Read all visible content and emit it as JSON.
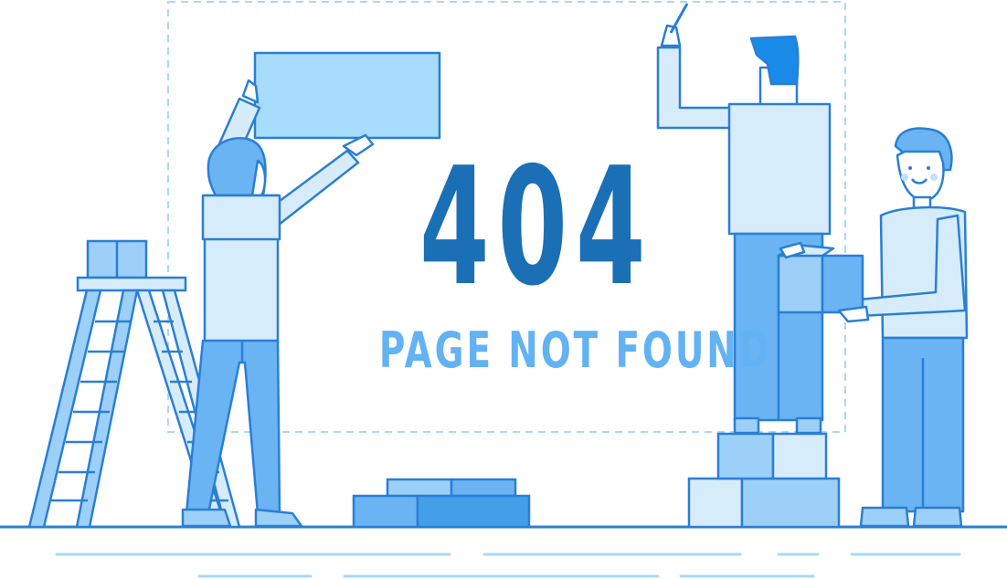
{
  "error": {
    "code": "404",
    "message": "PAGE NOT FOUND"
  },
  "illustration": {
    "scene": "workers building an error page",
    "elements": [
      "dashed-frame",
      "ladder",
      "worker-holding-panel",
      "worker-with-pencil",
      "worker-carrying-box",
      "brick-stack",
      "box-stack",
      "ground-lines"
    ]
  },
  "colors": {
    "primary_dark": "#1a6fb5",
    "primary_light": "#63b2f3",
    "outline": "#2a7fd4",
    "fill_light": "#d7ecfb",
    "fill_mid": "#9dd0f8",
    "fill_blue": "#6ab4f4"
  }
}
